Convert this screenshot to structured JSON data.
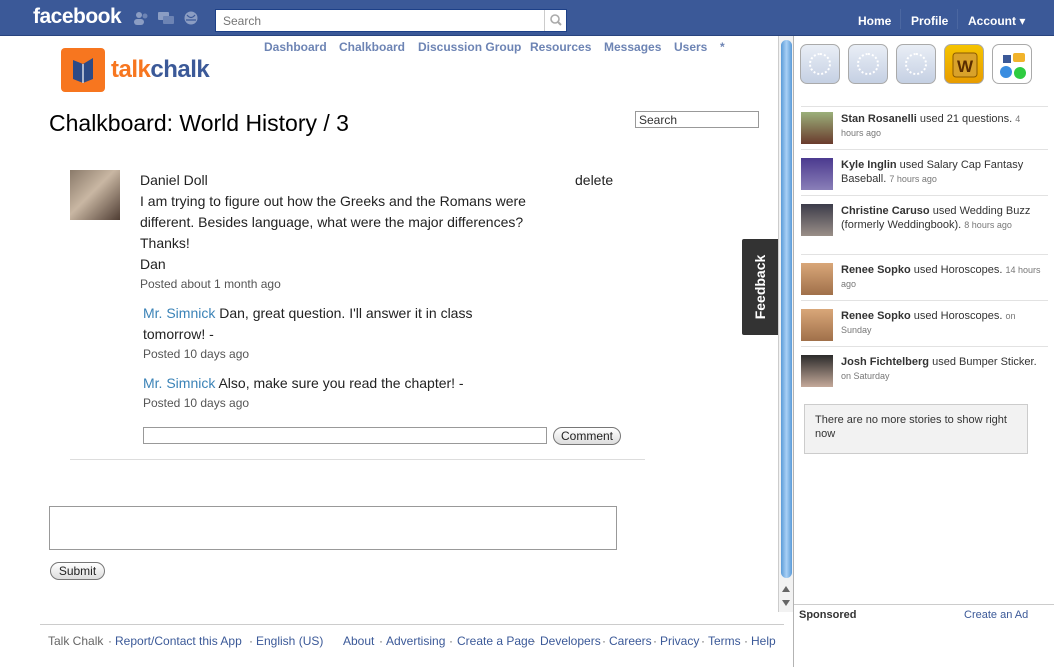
{
  "fbbar": {
    "logo": "facebook",
    "search_placeholder": "Search",
    "nav": [
      "Home",
      "Profile",
      "Account ▾"
    ]
  },
  "app": {
    "logo_part1": "talk",
    "logo_part2": "chalk",
    "nav": [
      "Dashboard",
      "Chalkboard",
      "Discussion Group",
      "Resources",
      "Messages",
      "Users",
      "*"
    ],
    "title": "Chalkboard: World History / 3",
    "search_value": "Search"
  },
  "post": {
    "author": "Daniel Doll",
    "delete_label": "delete",
    "lines": [
      "I am trying to figure out how the Greeks and the Romans were",
      "different. Besides language, what were the major differences?",
      "Thanks!",
      "Dan"
    ],
    "posted": "Posted about 1 month ago",
    "replies": [
      {
        "author": "Mr. Simnick",
        "text1": "Dan, great question. I'll answer it in class",
        "text2": "tomorrow! -",
        "posted": "Posted 10 days ago"
      },
      {
        "author": "Mr. Simnick",
        "text1": "Also, make sure you read the chapter! -",
        "posted": "Posted 10 days ago"
      }
    ],
    "comment_button": "Comment"
  },
  "submit_button": "Submit",
  "feedback_label": "Feedback",
  "footer": {
    "left": [
      "Talk Chalk",
      "·",
      "Report/Contact this App",
      "·",
      "English (US)"
    ],
    "right": [
      "About",
      "·",
      "Advertising",
      "·",
      "Create a Page",
      "·",
      "Developers",
      "·",
      "Careers",
      "·",
      "Privacy",
      "·",
      "Terms",
      "·",
      "Help"
    ]
  },
  "sidebar": {
    "stories": [
      {
        "name": "Stan Rosanelli",
        "action": " used 21 questions.",
        "time": "4 hours ago"
      },
      {
        "name": "Kyle Inglin",
        "action": " used Salary Cap Fantasy Baseball.",
        "time": "7 hours ago"
      },
      {
        "name": "Christine Caruso",
        "action": " used Wedding Buzz (formerly Weddingbook).",
        "time": "8 hours ago"
      },
      {
        "name": "Renee Sopko",
        "action": " used Horoscopes.",
        "time": "14 hours ago"
      },
      {
        "name": "Renee Sopko",
        "action": " used Horoscopes.",
        "time": "on Sunday"
      },
      {
        "name": "Josh Fichtelberg",
        "action": " used Bumper Sticker.",
        "time": "on Saturday"
      }
    ],
    "no_more": "There are no more stories to show right now",
    "sponsored": "Sponsored",
    "create_ad": "Create an Ad"
  }
}
